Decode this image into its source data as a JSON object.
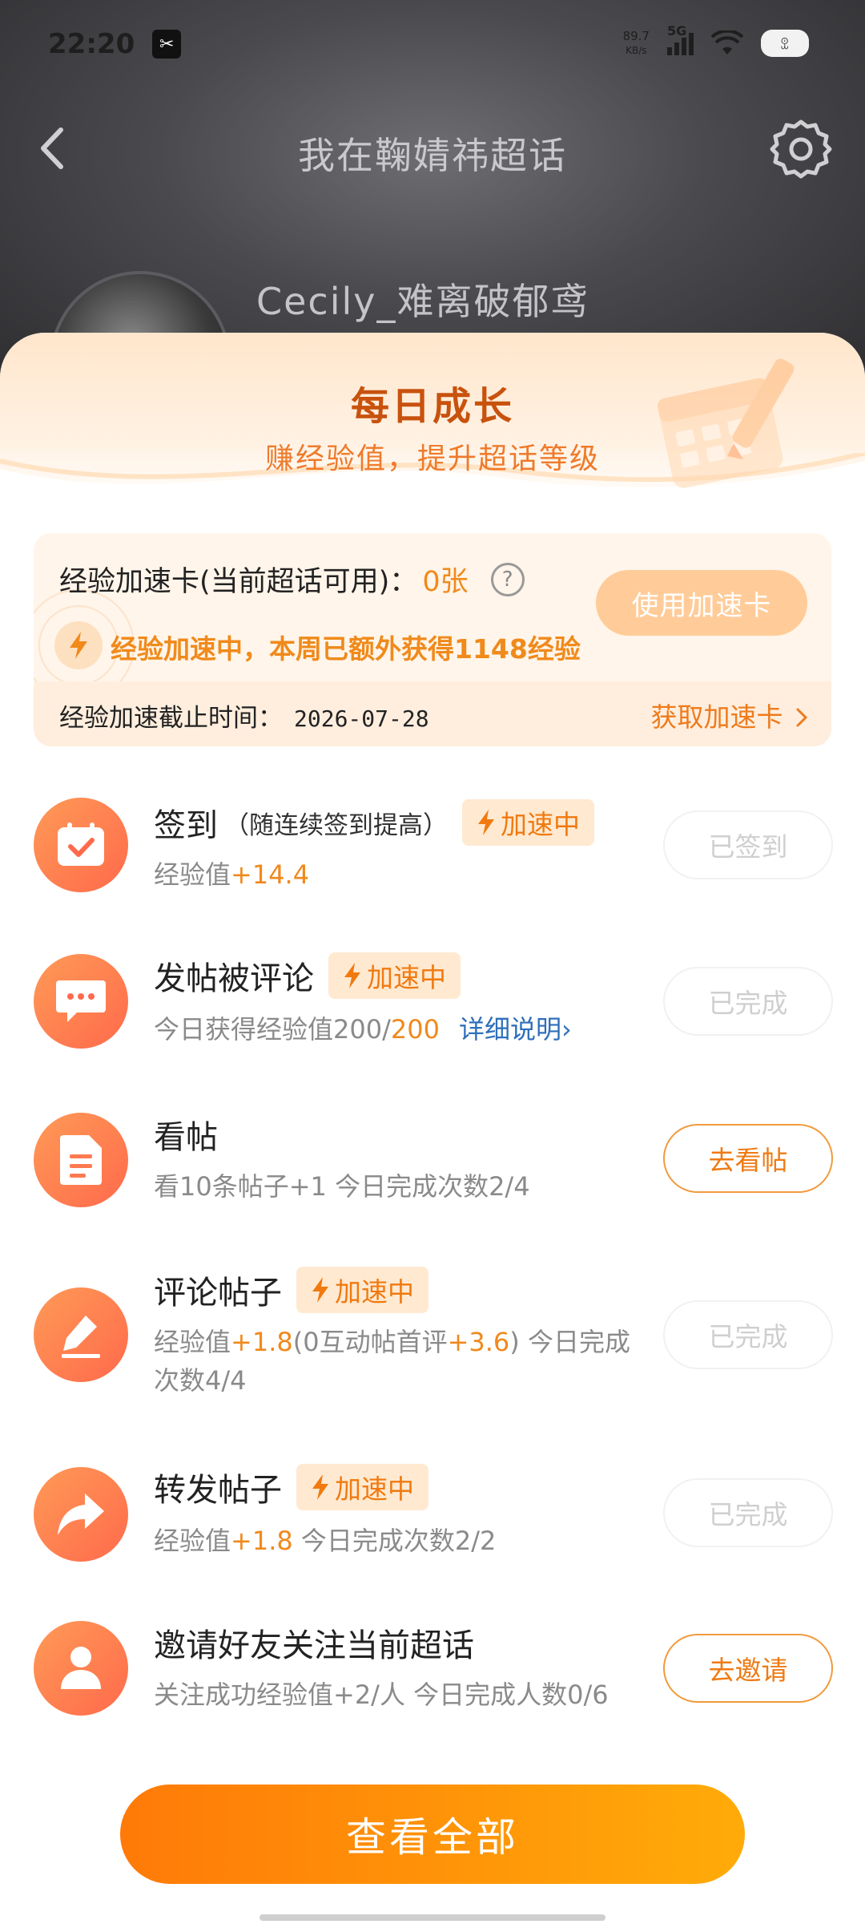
{
  "status_bar": {
    "time": "22:20",
    "app_badge": "✂",
    "net_speed_value": "89.7",
    "net_speed_unit": "KB/s",
    "network": "5G",
    "battery": "ꀾ"
  },
  "header": {
    "title": "我在鞠婧祎超话",
    "profile_name": "Cecily_难离破郁鸢"
  },
  "sheet": {
    "title": "每日成长",
    "subtitle": "赚经验值，提升超话等级"
  },
  "accelerator": {
    "label": "经验加速卡(当前超话可用)：",
    "count": "0张",
    "help": "?",
    "use_button": "使用加速卡",
    "status": "经验加速中，本周已额外获得1148经验",
    "deadline_label": "经验加速截止时间：",
    "deadline_date": "2026-07-28",
    "get_card_link": "获取加速卡"
  },
  "tasks": [
    {
      "title": "签到",
      "note": "（随连续签到提高）",
      "badge": "加速中",
      "desc_prefix": "经验值",
      "desc_value": "+14.4",
      "button": "已签到"
    },
    {
      "title": "发帖被评论",
      "badge": "加速中",
      "desc_prefix": "今日获得经验值200/",
      "desc_value": "200",
      "desc_link": "详细说明›",
      "button": "已完成"
    },
    {
      "title": "看帖",
      "desc": "看10条帖子+1   今日完成次数2/4",
      "button": "去看帖"
    },
    {
      "title": "评论帖子",
      "badge": "加速中",
      "desc_p1": "经验值",
      "desc_v1": "+1.8",
      "desc_p2": "(0互动帖首评",
      "desc_v2": "+3.6",
      "desc_p3": ")   今日完成次数4/4",
      "button": "已完成"
    },
    {
      "title": "转发帖子",
      "badge": "加速中",
      "desc_prefix": "经验值",
      "desc_value": "+1.8",
      "desc_suffix": "   今日完成次数2/2",
      "button": "已完成"
    },
    {
      "title": "邀请好友关注当前超话",
      "desc": "关注成功经验值+2/人   今日完成人数0/6",
      "button": "去邀请"
    }
  ],
  "view_all": "查看全部",
  "colors": {
    "accent_orange": "#f0891c",
    "icon_gradient_start": "#ff9a56",
    "icon_gradient_end": "#ff6a4c",
    "cta_start": "#ff7a08",
    "cta_end": "#ffab09"
  }
}
